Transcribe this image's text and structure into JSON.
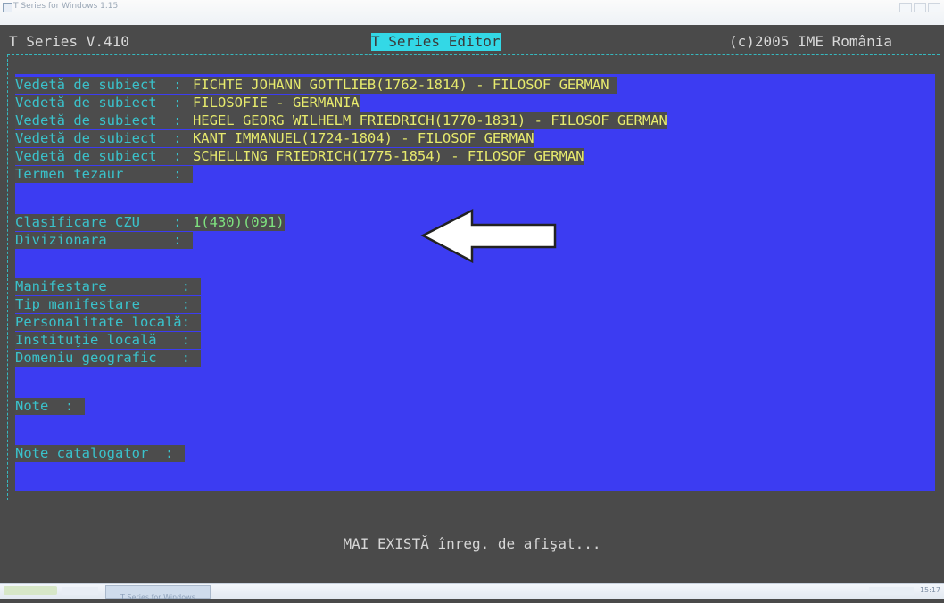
{
  "window": {
    "title": "T Series for Windows 1.15"
  },
  "header": {
    "left": "T Series V.410",
    "center": "T Series Editor",
    "right": "(c)2005 IME România"
  },
  "fields": [
    {
      "label": "Vedetă de subiect  : ",
      "value": "FICHTE JOHANN GOTTLIEB(1762-1814) - FILOSOF GERMAN"
    },
    {
      "label": "Vedetă de subiect  : ",
      "value": "FILOSOFIE - GERMANIA"
    },
    {
      "label": "Vedetă de subiect  : ",
      "value": "HEGEL GEORG WILHELM FRIEDRICH(1770-1831) - FILOSOF GERMAN"
    },
    {
      "label": "Vedetă de subiect  : ",
      "value": "KANT IMMANUEL(1724-1804) - FILOSOF GERMAN"
    },
    {
      "label": "Vedetă de subiect  : ",
      "value": "SCHELLING FRIEDRICH(1775-1854) - FILOSOF GERMAN"
    },
    {
      "label": "Termen tezaur      : ",
      "value": ""
    },
    {
      "label": "Clasificare CZU    : ",
      "value": "1(430)(091)"
    },
    {
      "label": "Divizionara        : ",
      "value": ""
    },
    {
      "label": "Manifestare         : ",
      "value": ""
    },
    {
      "label": "Tip manifestare     : ",
      "value": ""
    },
    {
      "label": "Personalitate locală: ",
      "value": ""
    },
    {
      "label": "Instituţie locală   : ",
      "value": ""
    },
    {
      "label": "Domeniu geografic   : ",
      "value": ""
    },
    {
      "label": "Note  : ",
      "value": ""
    },
    {
      "label": "Note catalogator  : ",
      "value": ""
    }
  ],
  "status": "MAI EXISTĂ înreg. de afişat...",
  "taskbar": {
    "task_label": "T Series for Windows",
    "clock": "15:17"
  },
  "colors": {
    "editor_bg": "#3c3cf2",
    "console_bg": "#4a4a4a",
    "label": "#3ac2cb",
    "value": "#e7ea6d",
    "value_green": "#7fe27f",
    "header_highlight": "#33d8e6"
  }
}
